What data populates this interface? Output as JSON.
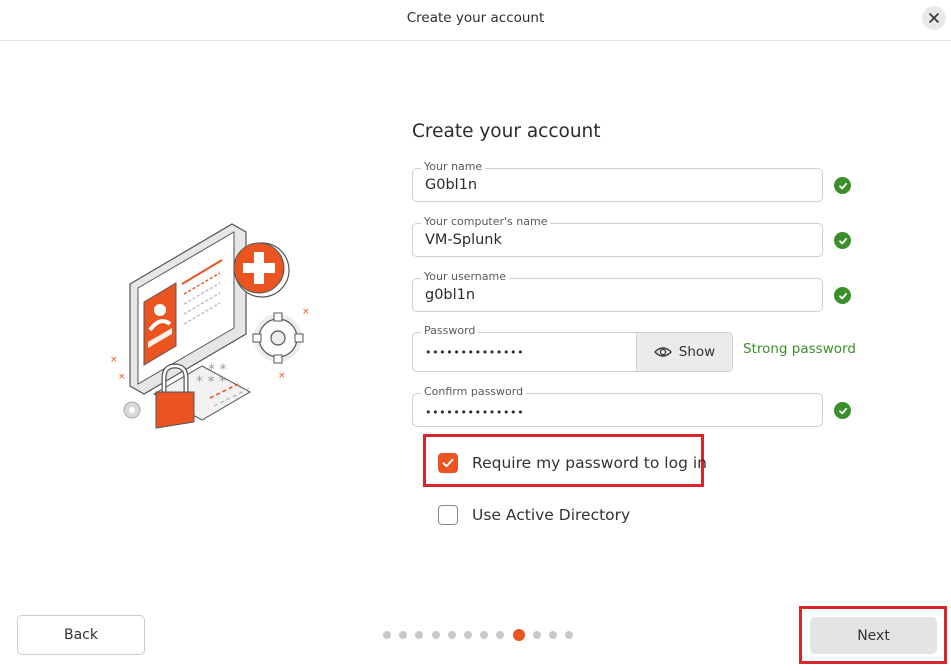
{
  "window": {
    "title": "Create your account"
  },
  "form": {
    "heading": "Create your account",
    "your_name": {
      "label": "Your name",
      "value": "G0bl1n",
      "valid": true
    },
    "computer_name": {
      "label": "Your computer's name",
      "value": "VM-Splunk",
      "valid": true
    },
    "username": {
      "label": "Your username",
      "value": "g0bl1n",
      "valid": true
    },
    "password": {
      "label": "Password",
      "value": "••••••••••••••",
      "show_label": "Show",
      "strength": "Strong password"
    },
    "confirm_password": {
      "label": "Confirm password",
      "value": "••••••••••••••",
      "valid": true
    },
    "require_password": {
      "label": "Require my password to log in",
      "checked": true
    },
    "active_directory": {
      "label": "Use Active Directory",
      "checked": false
    }
  },
  "navigation": {
    "back_label": "Back",
    "next_label": "Next"
  },
  "progress": {
    "total_steps": 12,
    "current_step": 9
  },
  "colors": {
    "accent": "#e95420",
    "success": "#3a8f2b",
    "highlight": "#d9252c"
  }
}
